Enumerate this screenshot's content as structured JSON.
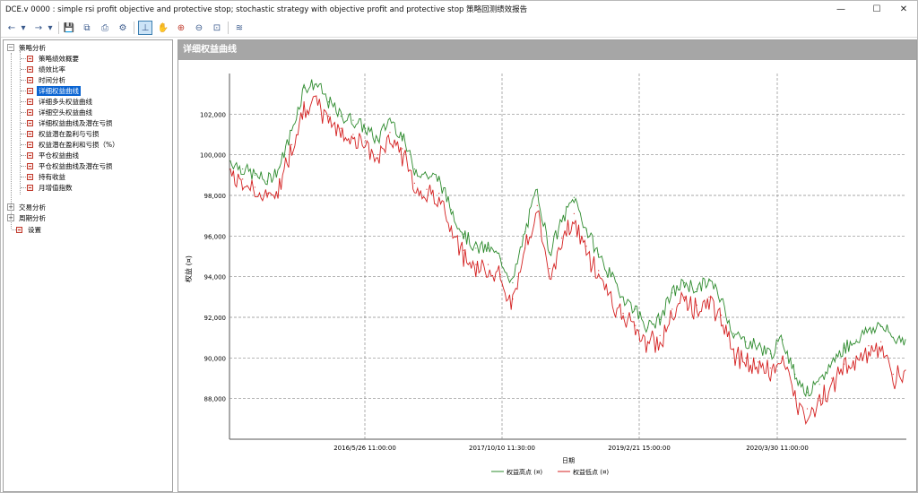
{
  "window": {
    "title": "DCE.v 0000 : simple rsi profit objective and protective stop; stochastic strategy with objective profit and protective stop 策略回测绩效报告",
    "controls": {
      "minimize": "—",
      "maximize": "☐",
      "close": "✕"
    }
  },
  "toolbar": {
    "buttons": [
      {
        "name": "back-icon",
        "glyph": "←"
      },
      {
        "name": "back-dropdown-icon",
        "glyph": "▾"
      },
      {
        "name": "forward-icon",
        "glyph": "→"
      },
      {
        "name": "forward-dropdown-icon",
        "glyph": "▾"
      },
      {
        "name": "save-icon",
        "glyph": "💾"
      },
      {
        "name": "export-icon",
        "glyph": "⧉"
      },
      {
        "name": "print-icon",
        "glyph": "⎙"
      },
      {
        "name": "settings-icon",
        "glyph": "⚙"
      },
      {
        "name": "crosshair-icon",
        "glyph": "⊥"
      },
      {
        "name": "pan-icon",
        "glyph": "✋"
      },
      {
        "name": "zoom-in-icon",
        "glyph": "⊕"
      },
      {
        "name": "zoom-out-icon",
        "glyph": "⊖"
      },
      {
        "name": "zoom-fit-icon",
        "glyph": "⊡"
      },
      {
        "name": "chart-style-icon",
        "glyph": "≋"
      }
    ]
  },
  "sidebar": {
    "groups": [
      {
        "label": "策略分析",
        "expander": "−",
        "items": [
          "策略绩效概要",
          "绩效比率",
          "时间分析",
          "详细权益曲线",
          "详细多头权益曲线",
          "详细空头权益曲线",
          "详细权益曲线及潜在亏损",
          "权益潜在盈利与亏损",
          "权益潜在盈利和亏损（%）",
          "平仓权益曲线",
          "平仓权益曲线及潜在亏损",
          "持有收益",
          "月增值指数"
        ]
      },
      {
        "label": "交易分析",
        "expander": "+",
        "items": []
      },
      {
        "label": "周期分析",
        "expander": "+",
        "items": []
      }
    ],
    "standalone": "设置",
    "selected": "详细权益曲线"
  },
  "content": {
    "header": "详细权益曲线"
  },
  "chart_data": {
    "type": "line",
    "ylabel": "权益 (¤)",
    "xlabel": "日期",
    "ylim": [
      86000,
      104000
    ],
    "yticks": [
      "88,000",
      "90,000",
      "92,000",
      "94,000",
      "96,000",
      "98,000",
      "100,000",
      "102,000"
    ],
    "ytick_values": [
      88000,
      90000,
      92000,
      94000,
      96000,
      98000,
      100000,
      102000
    ],
    "xticks": [
      "2016/5/26 11:00:00",
      "2017/10/10 11:30:00",
      "2019/2/21 15:00:00",
      "2020/3/30 11:00:00"
    ],
    "grid": true,
    "legend_position": "bottom-center",
    "colors": {
      "high": "#2e8b2e",
      "low": "#d42020"
    },
    "series": [
      {
        "name": "权益高点 (¤)",
        "values": [
          99700,
          99300,
          99000,
          98700,
          99400,
          101200,
          103300,
          103500,
          102600,
          101900,
          101700,
          101300,
          100700,
          101800,
          100900,
          99300,
          99000,
          98800,
          97300,
          96100,
          95400,
          95400,
          94900,
          93700,
          96200,
          98300,
          95200,
          96700,
          97900,
          96300,
          95100,
          94000,
          93000,
          92400,
          91500,
          91900,
          93200,
          93700,
          93400,
          93800,
          92900,
          91200,
          90800,
          90600,
          90200,
          90900,
          89200,
          88300,
          88700,
          89800,
          90500,
          90900,
          91400,
          91600,
          91000,
          90900
        ]
      },
      {
        "name": "权益低点 (¤)",
        "values": [
          99300,
          98800,
          98400,
          98100,
          98800,
          100500,
          102600,
          102900,
          101900,
          101300,
          101000,
          100700,
          100000,
          101100,
          100300,
          98600,
          98300,
          98100,
          96500,
          95300,
          94600,
          94600,
          94100,
          92900,
          95400,
          97500,
          94400,
          95900,
          97100,
          95500,
          94300,
          93200,
          92200,
          91600,
          90800,
          91100,
          92400,
          93000,
          92600,
          93000,
          92100,
          90400,
          90000,
          89800,
          89500,
          90100,
          88300,
          87500,
          87900,
          89000,
          89700,
          90100,
          90600,
          90800,
          89200,
          89400
        ]
      }
    ]
  }
}
